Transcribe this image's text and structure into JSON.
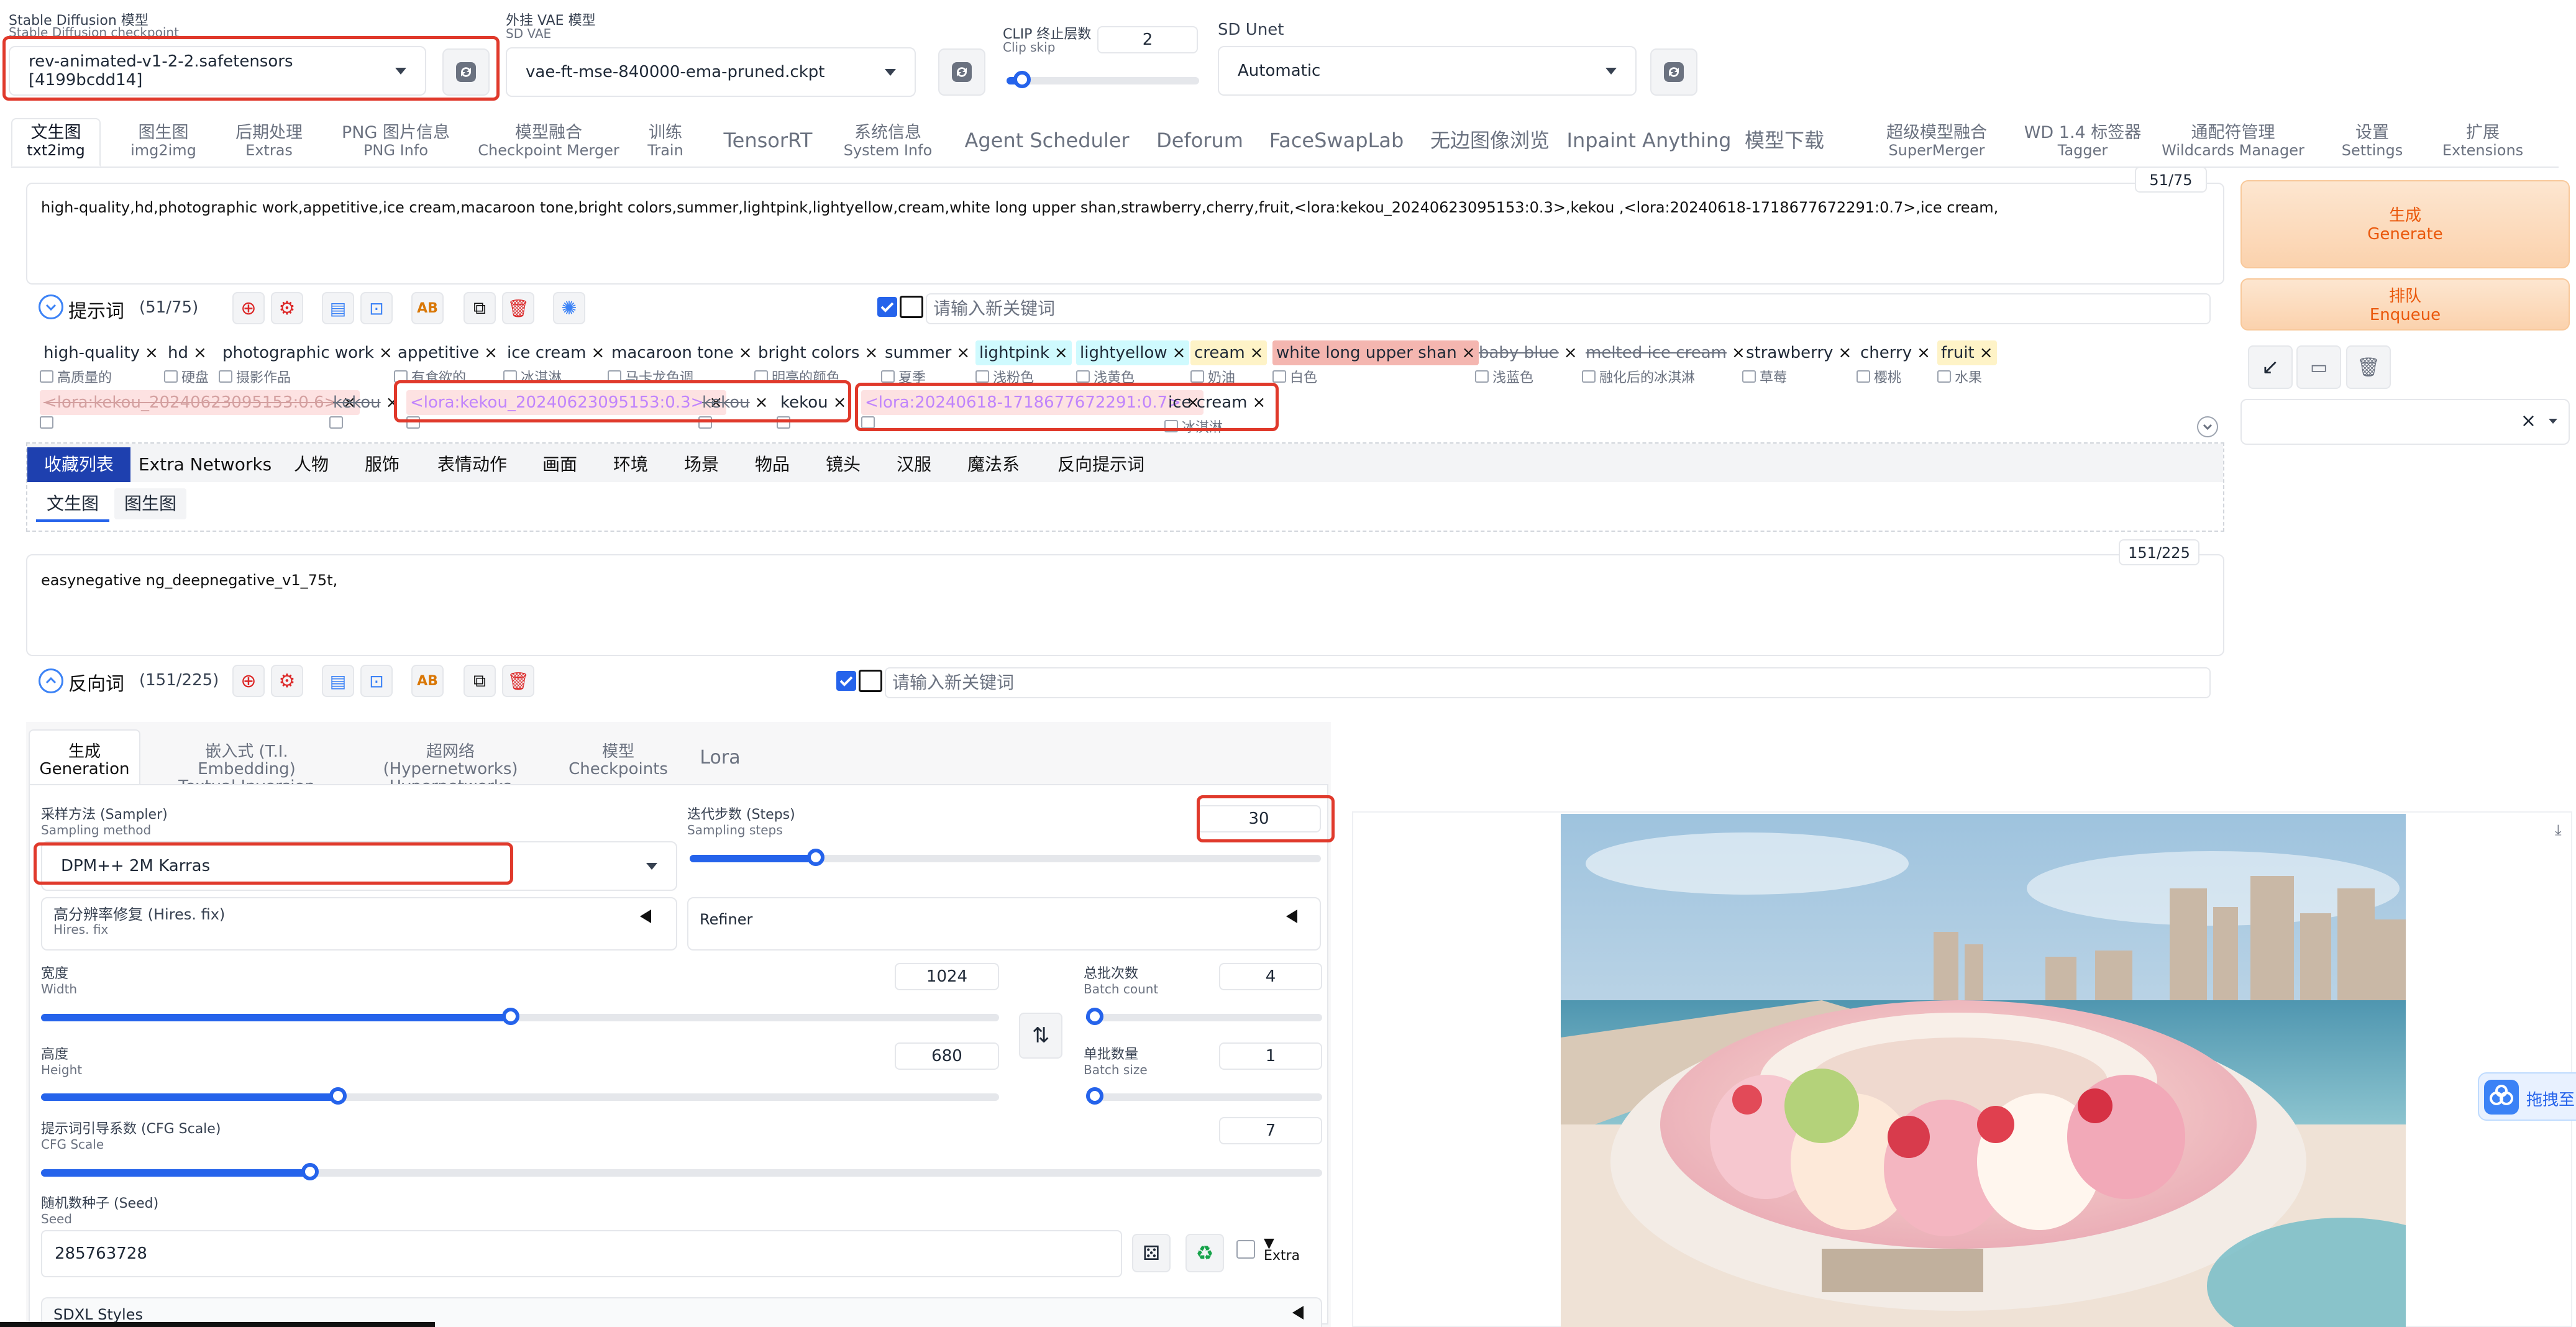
{
  "top": {
    "checkpoint_label_cn": "Stable Diffusion 模型",
    "checkpoint_label_en": "Stable Diffusion checkpoint",
    "checkpoint_value": "rev-animated-v1-2-2.safetensors [4199bcdd14]",
    "vae_label_cn": "外挂 VAE 模型",
    "vae_label_en": "SD VAE",
    "vae_value": "vae-ft-mse-840000-ema-pruned.ckpt",
    "clip_label_cn": "CLIP 终止层数",
    "clip_label_en": "Clip skip",
    "clip_value": "2",
    "clip_fraction": 0.08,
    "unet_label": "SD Unet",
    "unet_value": "Automatic"
  },
  "tabs": [
    {
      "cn": "文生图",
      "en": "txt2img"
    },
    {
      "cn": "图生图",
      "en": "img2img"
    },
    {
      "cn": "后期处理",
      "en": "Extras"
    },
    {
      "cn": "PNG 图片信息",
      "en": "PNG Info"
    },
    {
      "cn": "模型融合",
      "en": "Checkpoint Merger"
    },
    {
      "cn": "训练",
      "en": "Train"
    },
    {
      "cn": "TensorRT",
      "en": ""
    },
    {
      "cn": "系统信息",
      "en": "System Info"
    },
    {
      "cn": "Agent Scheduler",
      "en": ""
    },
    {
      "cn": "Deforum",
      "en": ""
    },
    {
      "cn": "FaceSwapLab",
      "en": ""
    },
    {
      "cn": "无边图像浏览",
      "en": ""
    },
    {
      "cn": "Inpaint Anything",
      "en": ""
    },
    {
      "cn": "模型下载",
      "en": ""
    },
    {
      "cn": "超级模型融合",
      "en": "SuperMerger"
    },
    {
      "cn": "WD 1.4 标签器",
      "en": "Tagger"
    },
    {
      "cn": "通配符管理",
      "en": "Wildcards Manager"
    },
    {
      "cn": "设置",
      "en": "Settings"
    },
    {
      "cn": "扩展",
      "en": "Extensions"
    }
  ],
  "prompt": {
    "text": "high-quality,hd,photographic work,appetitive,ice cream,macaroon tone,bright colors,summer,lightpink,lightyellow,cream,white long upper shan,strawberry,cherry,fruit,<lora:kekou_20240623095153:0.3>,kekou ,<lora:20240618-1718677672291:0.7>,ice cream,",
    "counter": "51/75",
    "title": "提示词",
    "count": "(51/75)",
    "keyword_placeholder": "请输入新关键词"
  },
  "tags_row1": [
    {
      "text": "high-quality",
      "trans": "高质量的"
    },
    {
      "text": "hd",
      "trans": "硬盘"
    },
    {
      "text": "photographic work",
      "trans": "摄影作品"
    },
    {
      "text": "appetitive",
      "trans": "有食欲的"
    },
    {
      "text": "ice cream",
      "trans": "冰淇淋"
    },
    {
      "text": "macaroon tone",
      "trans": "马卡龙色调"
    },
    {
      "text": "bright colors",
      "trans": "明亮的颜色"
    },
    {
      "text": "summer",
      "trans": "夏季"
    },
    {
      "text": "lightpink",
      "trans": "浅粉色"
    },
    {
      "text": "lightyellow",
      "trans": "浅黄色"
    },
    {
      "text": "cream",
      "trans": "奶油"
    },
    {
      "text": "white long upper shan",
      "trans": "白色"
    },
    {
      "text": "baby blue",
      "trans": "浅蓝色"
    },
    {
      "text": "melted ice cream",
      "trans": "融化后的冰淇淋"
    },
    {
      "text": "strawberry",
      "trans": "草莓"
    },
    {
      "text": "cherry",
      "trans": "樱桃"
    },
    {
      "text": "fruit",
      "trans": "水果"
    }
  ],
  "tags_row2": [
    {
      "text": "<lora:kekou_20240623095153:0.6>"
    },
    {
      "text": "kekou"
    },
    {
      "text": "<lora:kekou_20240623095153:0.3>"
    },
    {
      "text": "kekou"
    },
    {
      "text": "kekou"
    },
    {
      "text": "<lora:20240618-1718677672291:0.7>"
    },
    {
      "text": "ice cream",
      "trans": "冰淇淋"
    }
  ],
  "categories": [
    "收藏列表",
    "Extra Networks",
    "人物",
    "服饰",
    "表情动作",
    "画面",
    "环境",
    "场景",
    "物品",
    "镜头",
    "汉服",
    "魔法系",
    "反向提示词"
  ],
  "subtabs": [
    "文生图",
    "图生图"
  ],
  "negative": {
    "text": "easynegative ng_deepnegative_v1_75t,",
    "counter": "151/225",
    "title": "反向词",
    "count": "(151/225)",
    "keyword_placeholder": "请输入新关键词"
  },
  "buttons": {
    "generate_cn": "生成",
    "generate_en": "Generate",
    "enqueue_cn": "排队",
    "enqueue_en": "Enqueue"
  },
  "gen_tabs": [
    {
      "cn": "生成",
      "en": "Generation"
    },
    {
      "cn": "嵌入式 (T.I. Embedding)",
      "en": "Textual Inversion"
    },
    {
      "cn": "超网络 (Hypernetworks)",
      "en": "Hypernetworks"
    },
    {
      "cn": "模型",
      "en": "Checkpoints"
    },
    {
      "cn": "Lora",
      "en": ""
    }
  ],
  "params": {
    "sampler_cn": "采样方法 (Sampler)",
    "sampler_en": "Sampling method",
    "sampler_value": "DPM++ 2M Karras",
    "steps_cn": "迭代步数 (Steps)",
    "steps_en": "Sampling steps",
    "steps_value": "30",
    "steps_fraction": 0.2,
    "hires_cn": "高分辨率修复 (Hires. fix)",
    "hires_en": "Hires. fix",
    "refiner": "Refiner",
    "width_cn": "宽度",
    "width_en": "Width",
    "width_value": "1024",
    "width_fraction": 0.49,
    "height_cn": "高度",
    "height_en": "Height",
    "height_value": "680",
    "height_fraction": 0.31,
    "batch_count_cn": "总批次数",
    "batch_count_en": "Batch count",
    "batch_count_value": "4",
    "batch_count_fraction": 0.03,
    "batch_size_cn": "单批数量",
    "batch_size_en": "Batch size",
    "batch_size_value": "1",
    "batch_size_fraction": 0.0,
    "cfg_cn": "提示词引导系数 (CFG Scale)",
    "cfg_en": "CFG Scale",
    "cfg_value": "7",
    "cfg_fraction": 0.21,
    "seed_cn": "随机数种子 (Seed)",
    "seed_en": "Seed",
    "seed_value": "285763728",
    "extra": "Extra",
    "sdxl": "SDXL Styles"
  },
  "side_widget": "拖拽至"
}
